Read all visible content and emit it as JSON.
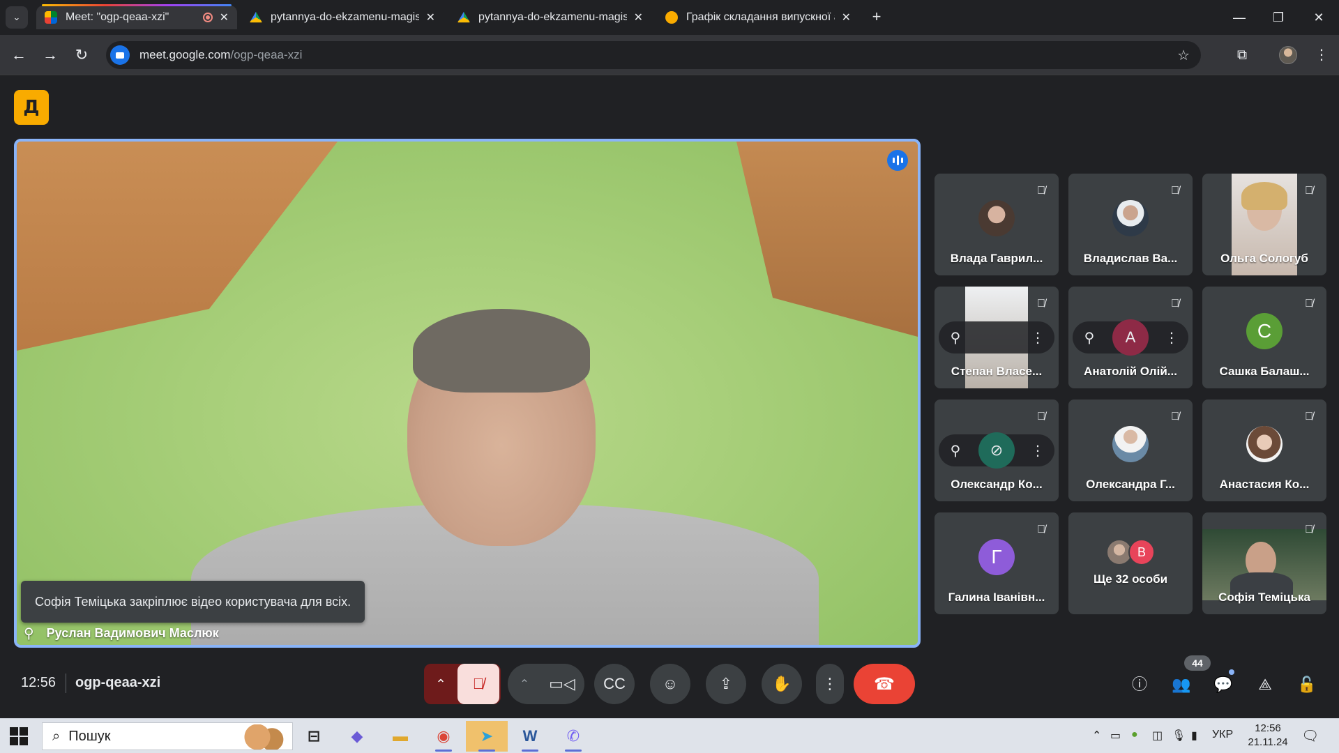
{
  "browser": {
    "tabs": [
      {
        "label": "Meet: \"ogp-qeaa-xzi\"",
        "active": true,
        "favicon": "google-meet-icon"
      },
      {
        "label": "pytannya-do-ekzamenu-magist",
        "active": false,
        "favicon": "google-drive-icon"
      },
      {
        "label": "pytannya-do-ekzamenu-magist",
        "active": false,
        "favicon": "google-drive-icon"
      },
      {
        "label": "Графік складання випускної ат",
        "active": false,
        "favicon": "chrome-web-icon"
      }
    ],
    "new_tab": "+",
    "url_host": "meet.google.com",
    "url_path": "/ogp-qeaa-xzi"
  },
  "meet": {
    "logo_glyph": "Д",
    "main": {
      "toast": "Софія Теміцька закріплює відео користувача для всіх.",
      "speaker_name": "Руслан Вадимович Маслюк"
    },
    "tiles": [
      {
        "name": "Влада Гаврил...",
        "avatar_type": "photo",
        "avatar_color": "#5a4a40"
      },
      {
        "name": "Владислав Ва...",
        "avatar_type": "photo",
        "avatar_color": "#6f7b88"
      },
      {
        "name": "Ольга Сологуб",
        "avatar_type": "video",
        "avatar_color": "#d7c7bc"
      },
      {
        "name": "Степан Власе...",
        "avatar_type": "video-hover",
        "avatar_color": "#b3a79d"
      },
      {
        "name": "Анатолій Олій...",
        "avatar_type": "hover",
        "avatar_color": "#8e2a46",
        "letter": "A"
      },
      {
        "name": "Сашка Балаш...",
        "avatar_type": "letter",
        "avatar_color": "#5a9e36",
        "letter": "С"
      },
      {
        "name": "Олександр Ко...",
        "avatar_type": "hover",
        "avatar_color": "#1f6b5a",
        "letter": "⊘"
      },
      {
        "name": "Олександра Г...",
        "avatar_type": "photo",
        "avatar_color": "#8fa3b4"
      },
      {
        "name": "Анастасия Ко...",
        "avatar_type": "photo",
        "avatar_color": "#e9dcd4"
      },
      {
        "name": "Галина Іванівн...",
        "avatar_type": "letter",
        "avatar_color": "#8e5cd9",
        "letter": "Г"
      },
      {
        "name": "Ще 32 особи",
        "avatar_type": "more",
        "more_letter": "В",
        "more_color": "#e8445a"
      },
      {
        "name": "Софія Теміцька",
        "avatar_type": "video",
        "avatar_color": "#6f8068"
      }
    ],
    "bottom": {
      "time": "12:56",
      "meeting_code": "ogp-qeaa-xzi",
      "participants_count": "44"
    }
  },
  "taskbar": {
    "search_placeholder": "Пошук",
    "tray_lang": "УКР",
    "clock_time": "12:56",
    "clock_date": "21.11.24"
  }
}
